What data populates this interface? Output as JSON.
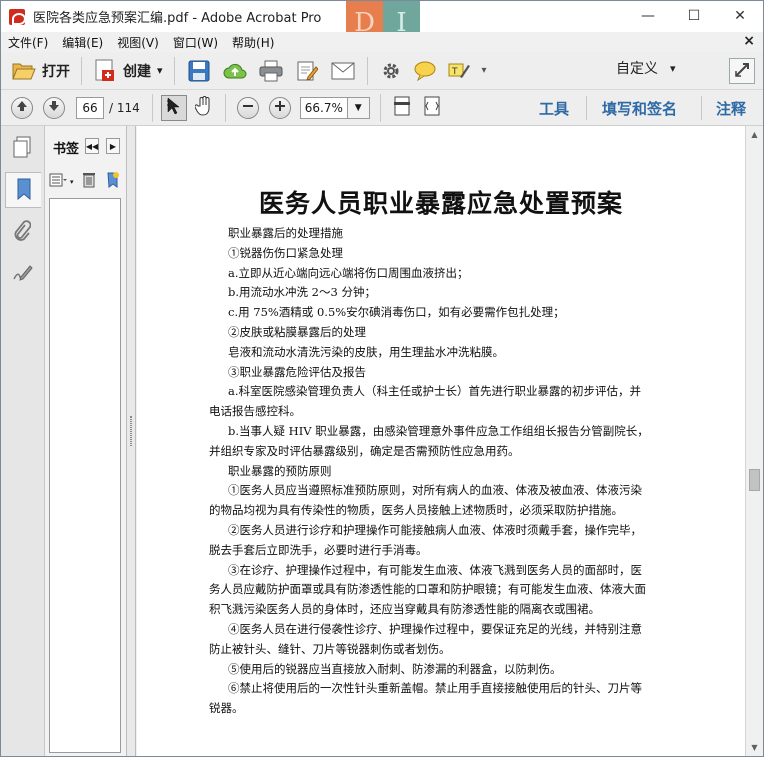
{
  "window": {
    "title": "医院各类应急预案汇编.pdf - Adobe Acrobat Pro",
    "badge_left": "D",
    "badge_right": "I",
    "minimize": "—",
    "maximize": "☐",
    "close": "✕"
  },
  "menu": {
    "items": [
      "文件(F)",
      "编辑(E)",
      "视图(V)",
      "窗口(W)",
      "帮助(H)"
    ],
    "close_doc": "×"
  },
  "toolbar1": {
    "open_label": "打开",
    "create_label": "创建",
    "create_arrow": "▾",
    "more_arrow": "▾",
    "customize_label": "自定义",
    "customize_arrow": "▾"
  },
  "toolbar2": {
    "page_current": "66",
    "page_total": "/ 114",
    "zoom_value": "66.7%",
    "zoom_arrow": "▼",
    "tools_label": "工具",
    "fill_sign_label": "填写和签名",
    "comment_label": "注释"
  },
  "panel": {
    "title": "书签",
    "collapse": "◀◀",
    "next": "▶"
  },
  "document": {
    "title": "医务人员职业暴露应急处置预案",
    "lines": [
      {
        "text": "职业暴露后的处理措施",
        "indent": true
      },
      {
        "text": "①锐器伤伤口紧急处理",
        "indent": true
      },
      {
        "text": "a.立即从近心端向远心端将伤口周围血液挤出；",
        "indent": true
      },
      {
        "text": "b.用流动水冲洗 2～3 分钟；",
        "indent": true
      },
      {
        "text": "c.用 75%酒精或 0.5%安尔碘消毒伤口，如有必要需作包扎处理；",
        "indent": true
      },
      {
        "text": "②皮肤或粘膜暴露后的处理",
        "indent": true
      },
      {
        "text": "皂液和流动水清洗污染的皮肤，用生理盐水冲洗粘膜。",
        "indent": true
      },
      {
        "text": "③职业暴露危险评估及报告",
        "indent": true
      },
      {
        "text": "a.科室医院感染管理负责人（科主任或护士长）首先进行职业暴露的初步评估，并",
        "indent": true
      },
      {
        "text": "电话报告感控科。",
        "indent": false
      },
      {
        "text": "b.当事人疑 HIV 职业暴露，由感染管理意外事件应急工作组组长报告分管副院长，",
        "indent": true
      },
      {
        "text": "并组织专家及时评估暴露级别，确定是否需预防性应急用药。",
        "indent": false
      },
      {
        "text": "职业暴露的预防原则",
        "indent": true
      },
      {
        "text": "①医务人员应当遵照标准预防原则，对所有病人的血液、体液及被血液、体液污染",
        "indent": true
      },
      {
        "text": "的物品均视为具有传染性的物质，医务人员接触上述物质时，必须采取防护措施。",
        "indent": false
      },
      {
        "text": "②医务人员进行诊疗和护理操作可能接触病人血液、体液时须戴手套，操作完毕，",
        "indent": true
      },
      {
        "text": "脱去手套后立即洗手，必要时进行手消毒。",
        "indent": false
      },
      {
        "text": "③在诊疗、护理操作过程中，有可能发生血液、体液飞溅到医务人员的面部时，医",
        "indent": true
      },
      {
        "text": "务人员应戴防护面罩或具有防渗透性能的口罩和防护眼镜；有可能发生血液、体液大面",
        "indent": false
      },
      {
        "text": "积飞溅污染医务人员的身体时，还应当穿戴具有防渗透性能的隔离衣或围裙。",
        "indent": false
      },
      {
        "text": "④医务人员在进行侵袭性诊疗、护理操作过程中，要保证充足的光线，并特别注意",
        "indent": true
      },
      {
        "text": "防止被针头、缝针、刀片等锐器刺伤或者划伤。",
        "indent": false
      },
      {
        "text": "⑤使用后的锐器应当直接放入耐刺、防渗漏的利器盒，以防刺伤。",
        "indent": true
      },
      {
        "text": "⑥禁止将使用后的一次性针头重新盖帽。禁止用手直接接触使用后的针头、刀片等",
        "indent": true
      },
      {
        "text": "锐器。",
        "indent": false
      }
    ]
  },
  "scrollbar": {
    "up": "▲",
    "down": "▼",
    "position": 0.57
  }
}
